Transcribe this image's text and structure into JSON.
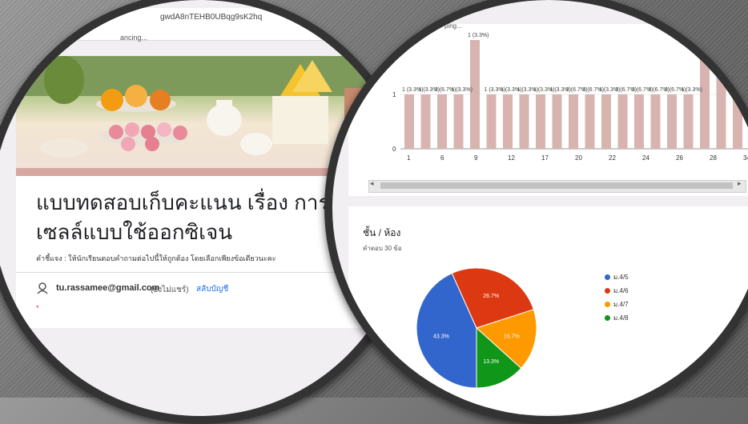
{
  "form": {
    "url_text": "gwdA8nTEHB0UBqg9sK2hq",
    "loading_text": "ancing...",
    "title": "แบบทดสอบเก็บคะแนน เรื่อง การหา เซลล์แบบใช้ออกซิเจน",
    "description": "คำชี้แจง : ให้นักเรียนตอบคำถามต่อไปนี้ให้ถูกต้อง โดยเลือกเพียงข้อเดียวนะคะ",
    "email": "tu.rassamee@gmail.com",
    "not_shared": "(ยังไม่แชร์)",
    "switch_account": "สลับบัญชี",
    "required_mark": "*"
  },
  "results": {
    "top_text": "ping...",
    "scroll_left": "◂",
    "scroll_right": "▸",
    "pie_title": "ชั้น / ห้อง",
    "pie_subtitle": "คำตอบ 30 ข้อ"
  },
  "chart_data": [
    {
      "type": "bar",
      "categories": [
        "1",
        "2",
        "3",
        "4",
        "5",
        "6",
        "7",
        "8",
        "9",
        "10",
        "11",
        "12",
        "13",
        "14",
        "15",
        "16",
        "17",
        "18",
        "19",
        "20",
        "21",
        "22",
        "23",
        "24",
        "25",
        "26",
        "27",
        "28",
        "29",
        "30",
        "31",
        "32",
        "33",
        "34"
      ],
      "values": [
        1,
        1,
        1,
        1,
        2,
        1,
        1,
        1,
        1,
        1,
        1,
        1,
        1,
        1,
        1,
        1,
        1,
        1,
        2,
        2,
        1,
        2,
        2,
        2,
        2,
        1,
        2,
        2,
        1,
        2,
        2,
        1,
        2,
        2
      ],
      "x_tick_labels": [
        "1",
        "6",
        "9",
        "12",
        "17",
        "20",
        "22",
        "24",
        "26",
        "28",
        "34"
      ],
      "y_ticks": [
        0,
        1
      ],
      "data_labels": [
        "1 (3.3%)",
        "1 (3.3%)",
        "2 (6.7%)",
        "1 (3.3%)",
        "1 (3.3%)",
        "1 (3.3%)",
        "1 (3.3%)",
        "1 (3.3%)",
        "1 (3.3%)",
        "1 (3.3%)",
        "2 (6.7%)",
        "2 (6.7%)",
        "1 (3.3%)",
        "2 (6.7%)",
        "2 (6.7%)",
        "2 (6.7%)",
        "2 (6.7%)",
        "1 (3.3%)",
        "1 (3.3%)",
        "2 (6.7%)"
      ],
      "bar_color": "#d8b4b0"
    },
    {
      "type": "pie",
      "labels": [
        "ม.4/5",
        "ม.4/6",
        "ม.4/7",
        "ม.4/8"
      ],
      "values": [
        43.3,
        26.7,
        16.7,
        13.3
      ],
      "value_labels": [
        "43.3%",
        "26.7%",
        "16.7%",
        "13.3%"
      ],
      "colors": [
        "#3366cc",
        "#dc3912",
        "#ff9900",
        "#109618"
      ],
      "legend_position": "right"
    }
  ]
}
